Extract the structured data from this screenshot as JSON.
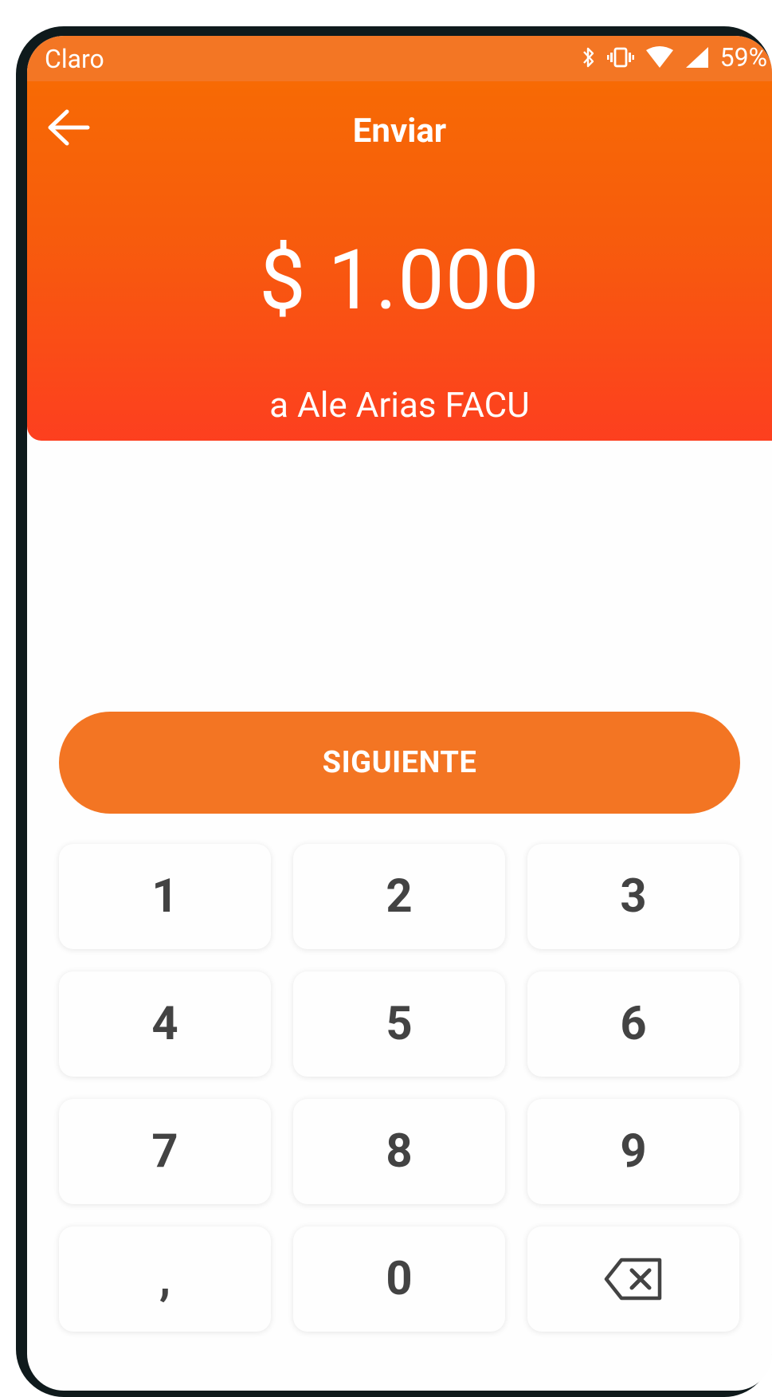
{
  "status_bar": {
    "carrier": "Claro",
    "battery": "59%",
    "icons": [
      "bluetooth-icon",
      "vibrate-icon",
      "wifi-icon",
      "signal-icon"
    ]
  },
  "header": {
    "title": "Enviar",
    "amount": "$ 1.000",
    "recipient": "a Ale Arias FACU",
    "back_icon": "arrow-left-icon"
  },
  "actions": {
    "next_label": "SIGUIENTE"
  },
  "keypad": {
    "keys": [
      "1",
      "2",
      "3",
      "4",
      "5",
      "6",
      "7",
      "8",
      "9",
      ",",
      "0"
    ],
    "backspace_icon": "backspace-icon"
  },
  "colors": {
    "accent": "#f37523",
    "header_top": "#f76a04",
    "header_bottom": "#fd3f1f",
    "key_text": "#434343"
  }
}
